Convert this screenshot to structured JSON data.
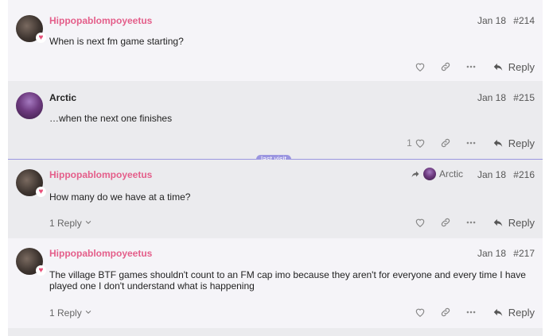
{
  "posts": [
    {
      "username": "Hippopablompoyeetus",
      "date": "Jan 18",
      "number": "#214",
      "text": "When is next fm game starting?",
      "reply_label": "Reply"
    },
    {
      "username": "Arctic",
      "date": "Jan 18",
      "number": "#215",
      "text": "…when the next one finishes",
      "like_count": "1",
      "reply_label": "Reply"
    },
    {
      "username": "Hippopablompoyeetus",
      "date": "Jan 18",
      "number": "#216",
      "reply_to": "Arctic",
      "text": "How many do we have at a time?",
      "replies_label": "1 Reply",
      "reply_label": "Reply"
    },
    {
      "username": "Hippopablompoyeetus",
      "date": "Jan 18",
      "number": "#217",
      "text": "The village BTF games shouldn't count to an FM cap imo because they aren't for everyone and every time I have played one I don't understand what is happening",
      "replies_label": "1 Reply",
      "reply_label": "Reply"
    }
  ],
  "last_visit_label": "last visit",
  "icons": {
    "like": "heart-icon",
    "link": "link-icon",
    "more": "ellipsis-icon",
    "reply": "reply-arrow-icon",
    "reply_to": "reply-to-arrow-icon",
    "expand": "chevron-down-icon"
  },
  "colors": {
    "username_accent": "#e45e8a",
    "last_visit": "#9b96e0"
  }
}
